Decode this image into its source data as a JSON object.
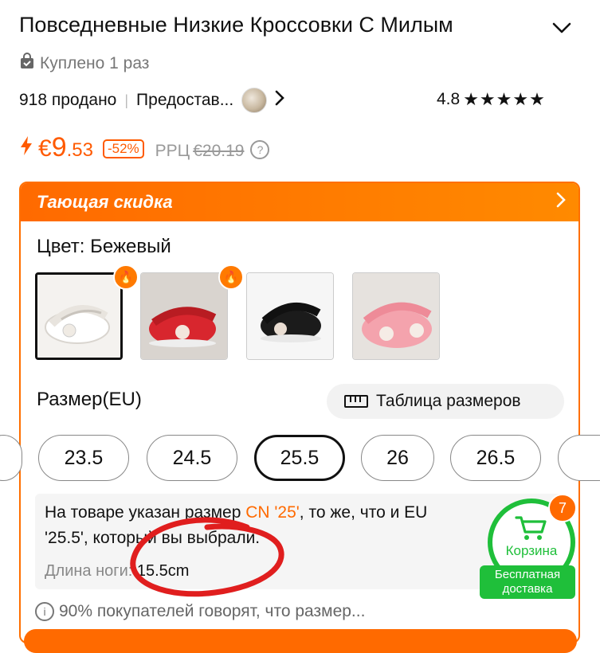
{
  "product": {
    "title": "Повседневные Низкие Кроссовки С Милым",
    "bought_text": "Куплено 1 раз",
    "sold_text": "918 продано",
    "provider_text": "Предостав...",
    "rating": "4.8",
    "stars": "★★★★★"
  },
  "price": {
    "currency": "€",
    "integer": "9",
    "decimal": ".53",
    "discount": "-52%",
    "rrp_label": "РРЦ",
    "old_price": "€20.19"
  },
  "promo": {
    "banner": "Тающая скидка"
  },
  "color": {
    "label": "Цвет: Бежевый",
    "options": [
      {
        "name": "beige",
        "selected": true,
        "hot": false
      },
      {
        "name": "red",
        "selected": false,
        "hot": true
      },
      {
        "name": "black",
        "selected": false,
        "hot": true
      },
      {
        "name": "pink",
        "selected": false,
        "hot": false
      }
    ]
  },
  "size": {
    "label": "Размер(EU)",
    "table_button": "Таблица размеров",
    "options": [
      "23.5",
      "24.5",
      "25.5",
      "26",
      "26.5"
    ],
    "selected": "25.5"
  },
  "size_info": {
    "line1_pre": "На товаре указан размер ",
    "line1_accent": "CN '25'",
    "line1_post": ", то же, что и EU",
    "line2": "'25.5', который вы выбрали.",
    "foot_label": "Длина ноги: ",
    "foot_value": "15.5cm"
  },
  "feedback": {
    "text": "90% покупателей говорят, что размер..."
  },
  "cart": {
    "label": "Корзина",
    "badge": "7",
    "free_shipping_line1": "Бесплатная",
    "free_shipping_line2": "доставка"
  },
  "colors": {
    "accent": "#ff6a00",
    "green": "#1fbf3a",
    "annotation": "#e01e1e"
  }
}
